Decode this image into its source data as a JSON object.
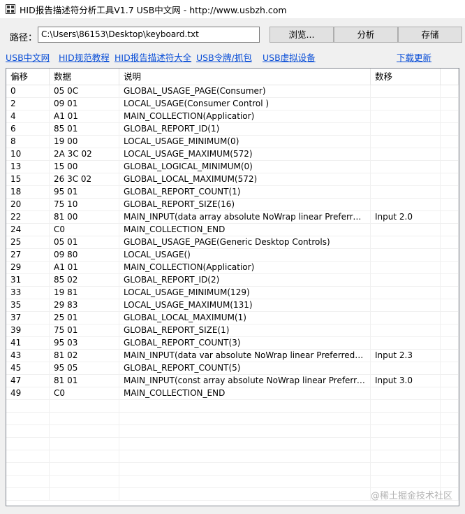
{
  "window": {
    "title": "HID报告描述符分析工具V1.7 USB中文网 - http://www.usbzh.com"
  },
  "path": {
    "label": "路径：",
    "value": "C:\\Users\\86153\\Desktop\\keyboard.txt"
  },
  "buttons": {
    "browse": "浏览...",
    "analyze": "分析",
    "save": "存储"
  },
  "links": {
    "usb_cn": "USB中文网",
    "hid_spec": "HID规范教程",
    "hid_desc": "HID报告描述符大全",
    "usb_token": "USB令牌/抓包",
    "usb_virtual": "USB虚拟设备",
    "download": "下载更新"
  },
  "table": {
    "headers": [
      "偏移",
      "数据",
      "说明",
      "数移",
      ""
    ],
    "rows": [
      {
        "offset": "0",
        "data": "05 0C",
        "desc": "GLOBAL_USAGE_PAGE(Consumer)",
        "extra": ""
      },
      {
        "offset": "2",
        "data": "09 01",
        "desc": "LOCAL_USAGE(Consumer Control )",
        "extra": ""
      },
      {
        "offset": "4",
        "data": "A1 01",
        "desc": "MAIN_COLLECTION(Applicatior)",
        "extra": ""
      },
      {
        "offset": "6",
        "data": "85 01",
        "desc": "GLOBAL_REPORT_ID(1)",
        "extra": ""
      },
      {
        "offset": "8",
        "data": "19 00",
        "desc": "LOCAL_USAGE_MINIMUM(0)",
        "extra": ""
      },
      {
        "offset": "10",
        "data": "2A 3C 02",
        "desc": "LOCAL_USAGE_MAXIMUM(572)",
        "extra": ""
      },
      {
        "offset": "13",
        "data": "15 00",
        "desc": "GLOBAL_LOGICAL_MINIMUM(0)",
        "extra": ""
      },
      {
        "offset": "15",
        "data": "26 3C 02",
        "desc": "GLOBAL_LOCAL_MAXIMUM(572)",
        "extra": ""
      },
      {
        "offset": "18",
        "data": "95 01",
        "desc": "GLOBAL_REPORT_COUNT(1)",
        "extra": ""
      },
      {
        "offset": "20",
        "data": "75 10",
        "desc": "GLOBAL_REPORT_SIZE(16)",
        "extra": ""
      },
      {
        "offset": "22",
        "data": "81 00",
        "desc": "MAIN_INPUT(data array absolute NoWrap linear PreferredSta...",
        "extra": "Input 2.0"
      },
      {
        "offset": "24",
        "data": "C0",
        "desc": "MAIN_COLLECTION_END",
        "extra": ""
      },
      {
        "offset": "25",
        "data": "05 01",
        "desc": "GLOBAL_USAGE_PAGE(Generic Desktop Controls)",
        "extra": ""
      },
      {
        "offset": "27",
        "data": "09 80",
        "desc": "LOCAL_USAGE()",
        "extra": ""
      },
      {
        "offset": "29",
        "data": "A1 01",
        "desc": "MAIN_COLLECTION(Applicatior)",
        "extra": ""
      },
      {
        "offset": "31",
        "data": "85 02",
        "desc": "GLOBAL_REPORT_ID(2)",
        "extra": ""
      },
      {
        "offset": "33",
        "data": "19 81",
        "desc": "LOCAL_USAGE_MINIMUM(129)",
        "extra": ""
      },
      {
        "offset": "35",
        "data": "29 83",
        "desc": "LOCAL_USAGE_MAXIMUM(131)",
        "extra": ""
      },
      {
        "offset": "37",
        "data": "25 01",
        "desc": "GLOBAL_LOCAL_MAXIMUM(1)",
        "extra": ""
      },
      {
        "offset": "39",
        "data": "75 01",
        "desc": "GLOBAL_REPORT_SIZE(1)",
        "extra": ""
      },
      {
        "offset": "41",
        "data": "95 03",
        "desc": "GLOBAL_REPORT_COUNT(3)",
        "extra": ""
      },
      {
        "offset": "43",
        "data": "81 02",
        "desc": "MAIN_INPUT(data var absolute NoWrap linear PreferredState...",
        "extra": "Input 2.3"
      },
      {
        "offset": "45",
        "data": "95 05",
        "desc": "GLOBAL_REPORT_COUNT(5)",
        "extra": ""
      },
      {
        "offset": "47",
        "data": "81 01",
        "desc": "MAIN_INPUT(const array absolute NoWrap linear PreferredSt...",
        "extra": "Input 3.0"
      },
      {
        "offset": "49",
        "data": "C0",
        "desc": "MAIN_COLLECTION_END",
        "extra": ""
      }
    ]
  },
  "watermark": "@稀土掘金技术社区",
  "colors": {
    "link": "#0b4fd7",
    "window_bg": "#f0f0f0",
    "grid_line": "#f0f0f0"
  },
  "icons": {
    "app": "app-grid-icon"
  }
}
